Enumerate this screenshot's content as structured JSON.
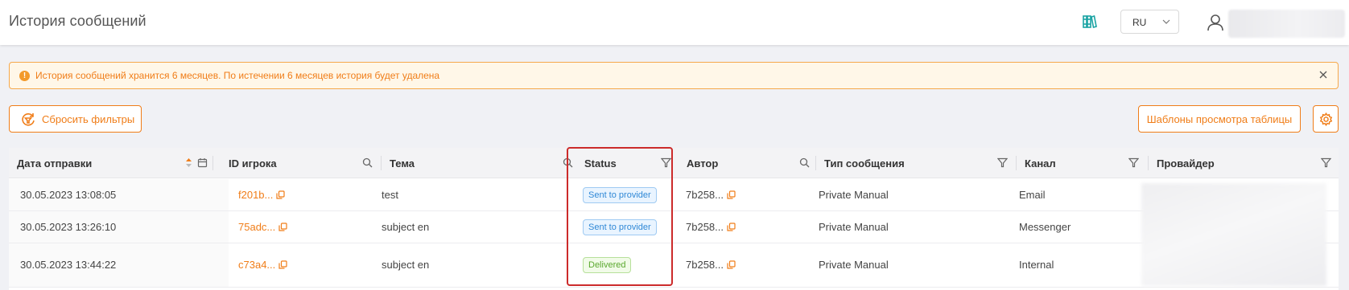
{
  "header": {
    "title": "История сообщений",
    "language": "RU"
  },
  "alert": {
    "icon": "!",
    "text": "История сообщений хранится 6 месяцев. По истечении 6 месяцев история будет удалена"
  },
  "toolbar": {
    "reset_filters": "Сбросить фильтры",
    "table_templates": "Шаблоны просмотра таблицы"
  },
  "table": {
    "columns": {
      "date": "Дата отправки",
      "player_id": "ID игрока",
      "subject": "Тема",
      "status": "Status",
      "author": "Автор",
      "message_type": "Тип сообщения",
      "channel": "Канал",
      "provider": "Провайдер"
    },
    "rows": [
      {
        "date": "30.05.2023 13:08:05",
        "player_id": "f201b...",
        "subject": "test",
        "status": "Sent to provider",
        "author": "7b258...",
        "message_type": "Private Manual",
        "channel": "Email"
      },
      {
        "date": "30.05.2023 13:26:10",
        "player_id": "75adc...",
        "subject": "subject en",
        "status": "Sent to provider",
        "author": "7b258...",
        "message_type": "Private Manual",
        "channel": "Messenger"
      },
      {
        "date": "30.05.2023 13:44:22",
        "player_id": "c73a4...",
        "subject": "subject en",
        "status": "Delivered",
        "author": "7b258...",
        "message_type": "Private Manual",
        "channel": "Internal"
      }
    ]
  },
  "colors": {
    "accent": "#f07d18",
    "status_sent": "#2f88d6",
    "status_delivered": "#5aa82e",
    "highlight": "#cc2b2b"
  }
}
